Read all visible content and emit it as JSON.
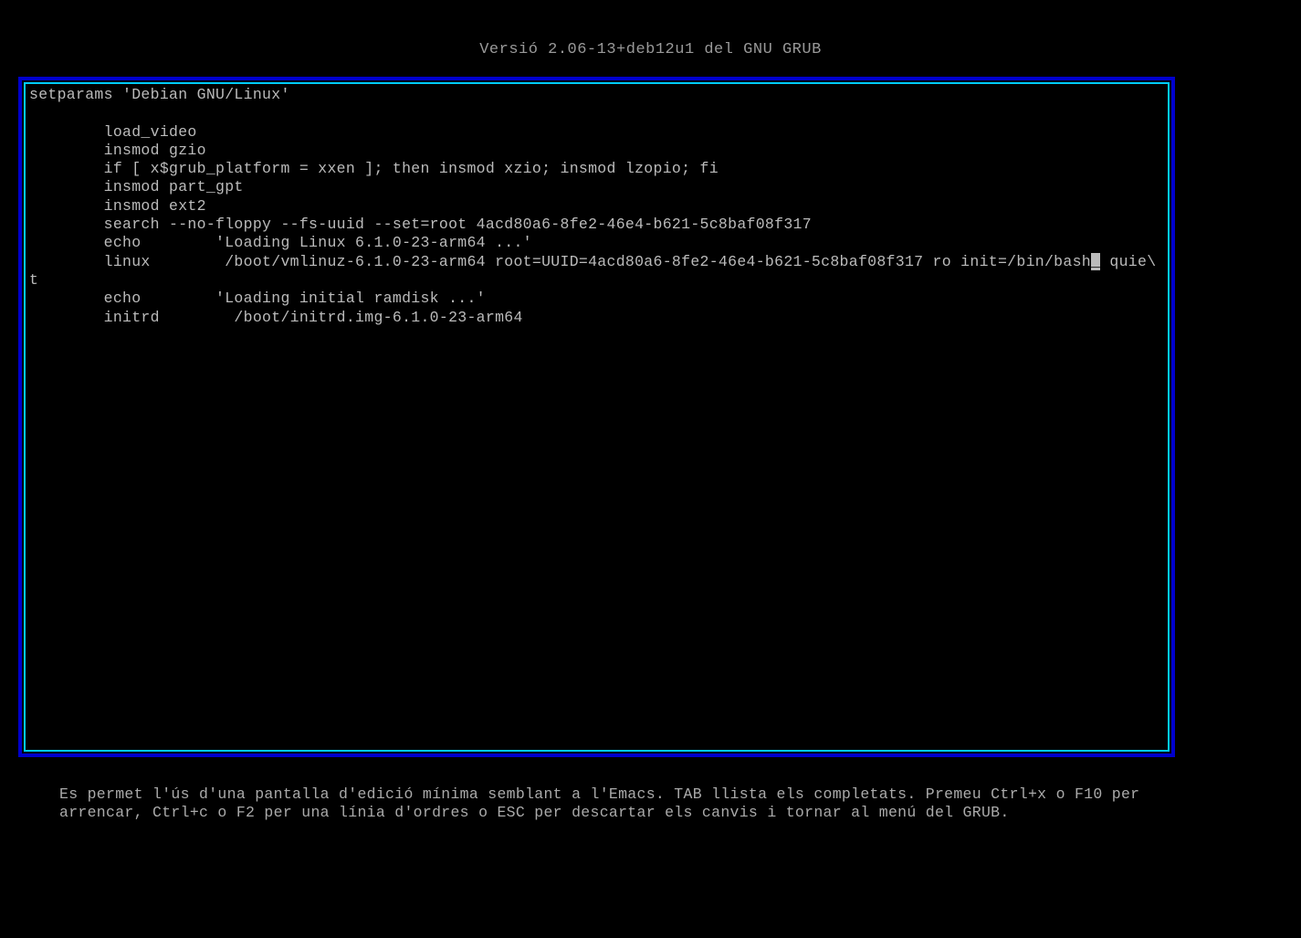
{
  "header": {
    "title": "Versió 2.06-13+deb12u1 del GNU GRUB"
  },
  "editor": {
    "lines": [
      "setparams 'Debian GNU/Linux'",
      "",
      "        load_video",
      "        insmod gzio",
      "        if [ x$grub_platform = xxen ]; then insmod xzio; insmod lzopio; fi",
      "        insmod part_gpt",
      "        insmod ext2",
      "        search --no-floppy --fs-uuid --set=root 4acd80a6-8fe2-46e4-b621-5c8baf08f317",
      "        echo        'Loading Linux 6.1.0-23-arm64 ...'",
      "        linux        /boot/vmlinuz-6.1.0-23-arm64 root=UUID=4acd80a6-8fe2-46e4-b621-5c8baf08f317 ro init=/bin/bash",
      " quie\\",
      "t",
      "        echo        'Loading initial ramdisk ...'",
      "        initrd        /boot/initrd.img-6.1.0-23-arm64"
    ],
    "cursor_char": "_"
  },
  "footer": {
    "help_text": "Es permet l'ús d'una pantalla d'edició mínima semblant a l'Emacs. TAB llista els completats. Premeu Ctrl+x o F10 per arrencar, Ctrl+c o F2 per una línia d'ordres o ESC per descartar els canvis i tornar al menú del GRUB."
  }
}
